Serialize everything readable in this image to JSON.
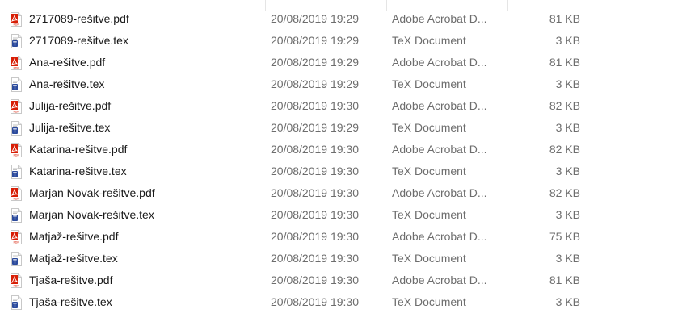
{
  "files": [
    {
      "name": "2717089-rešitve.pdf",
      "date": "20/08/2019 19:29",
      "type": "Adobe Acrobat D...",
      "size": "81 KB",
      "icon": "pdf-icon"
    },
    {
      "name": "2717089-rešitve.tex",
      "date": "20/08/2019 19:29",
      "type": "TeX Document",
      "size": "3 KB",
      "icon": "tex-icon"
    },
    {
      "name": "Ana-rešitve.pdf",
      "date": "20/08/2019 19:29",
      "type": "Adobe Acrobat D...",
      "size": "81 KB",
      "icon": "pdf-icon"
    },
    {
      "name": "Ana-rešitve.tex",
      "date": "20/08/2019 19:29",
      "type": "TeX Document",
      "size": "3 KB",
      "icon": "tex-icon"
    },
    {
      "name": "Julija-rešitve.pdf",
      "date": "20/08/2019 19:30",
      "type": "Adobe Acrobat D...",
      "size": "82 KB",
      "icon": "pdf-icon"
    },
    {
      "name": "Julija-rešitve.tex",
      "date": "20/08/2019 19:29",
      "type": "TeX Document",
      "size": "3 KB",
      "icon": "tex-icon"
    },
    {
      "name": "Katarina-rešitve.pdf",
      "date": "20/08/2019 19:30",
      "type": "Adobe Acrobat D...",
      "size": "82 KB",
      "icon": "pdf-icon"
    },
    {
      "name": "Katarina-rešitve.tex",
      "date": "20/08/2019 19:30",
      "type": "TeX Document",
      "size": "3 KB",
      "icon": "tex-icon"
    },
    {
      "name": "Marjan Novak-rešitve.pdf",
      "date": "20/08/2019 19:30",
      "type": "Adobe Acrobat D...",
      "size": "82 KB",
      "icon": "pdf-icon"
    },
    {
      "name": "Marjan Novak-rešitve.tex",
      "date": "20/08/2019 19:30",
      "type": "TeX Document",
      "size": "3 KB",
      "icon": "tex-icon"
    },
    {
      "name": "Matjaž-rešitve.pdf",
      "date": "20/08/2019 19:30",
      "type": "Adobe Acrobat D...",
      "size": "75 KB",
      "icon": "pdf-icon"
    },
    {
      "name": "Matjaž-rešitve.tex",
      "date": "20/08/2019 19:30",
      "type": "TeX Document",
      "size": "3 KB",
      "icon": "tex-icon"
    },
    {
      "name": "Tjaša-rešitve.pdf",
      "date": "20/08/2019 19:30",
      "type": "Adobe Acrobat D...",
      "size": "81 KB",
      "icon": "pdf-icon"
    },
    {
      "name": "Tjaša-rešitve.tex",
      "date": "20/08/2019 19:30",
      "type": "TeX Document",
      "size": "3 KB",
      "icon": "tex-icon"
    }
  ],
  "colors": {
    "pdf_red": "#d81e06",
    "tex_blue": "#2b4a9c",
    "secondary_text": "#6d6d6d",
    "primary_text": "#1a1a1a"
  }
}
